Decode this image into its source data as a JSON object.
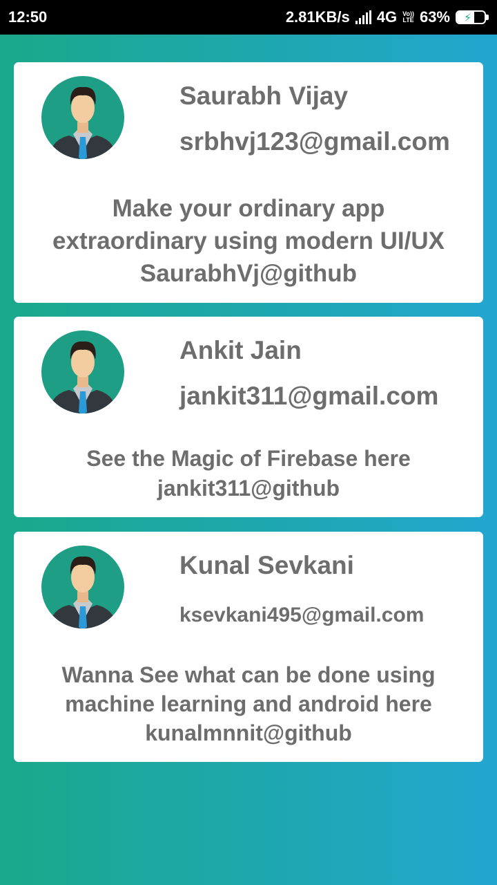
{
  "status_bar": {
    "time": "12:50",
    "speed": "2.81KB/s",
    "network": "4G",
    "volte_top": "Vo))",
    "volte_bottom": "LTE",
    "battery": "63%",
    "battery_level": 0.63
  },
  "cards": [
    {
      "name": "Saurabh Vijay",
      "email": "srbhvj123@gmail.com",
      "description": "Make your ordinary app\nextraordinary using modern UI/UX\nSaurabhVj@github"
    },
    {
      "name": "Ankit Jain",
      "email": "jankit311@gmail.com",
      "description": "See the Magic of Firebase here\njankit311@github"
    },
    {
      "name": "Kunal Sevkani",
      "email": "ksevkani495@gmail.com",
      "description": "Wanna See what  can be done using\nmachine learning and android here\nkunalmnnit@github"
    }
  ],
  "colors": {
    "gradient_start": "#1aa98a",
    "gradient_end": "#22a6cf",
    "avatar_bg": "#1e9e85",
    "text": "#6d6d6d"
  }
}
